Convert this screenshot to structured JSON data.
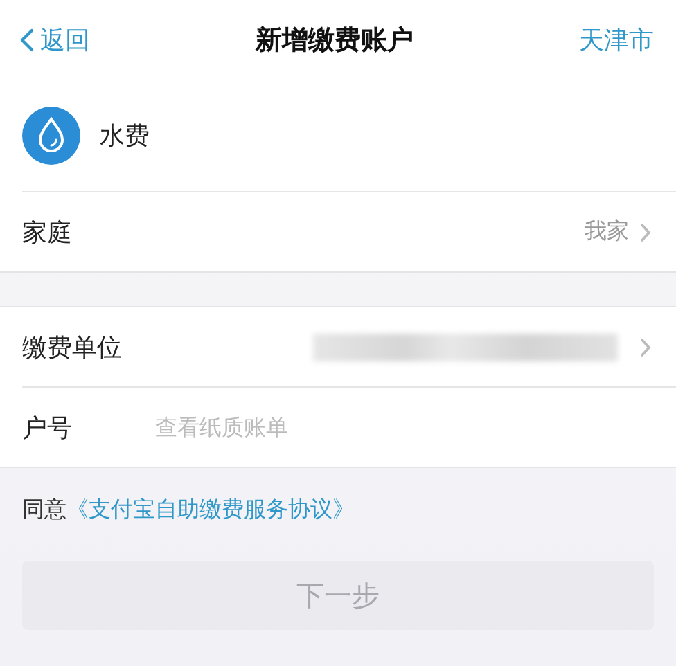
{
  "nav_bar": {
    "back": "返回",
    "title": "新增缴费账户",
    "city": "天津市"
  },
  "service": {
    "name": "水费"
  },
  "groups": [
    {
      "rows": [
        {
          "kind": "select",
          "label": "家庭",
          "value": "我家"
        }
      ]
    },
    {
      "rows": [
        {
          "kind": "select",
          "label": "缴费单位",
          "redacted": true
        },
        {
          "kind": "input",
          "label": "户号",
          "placeholder": "查看纸质账单"
        }
      ]
    }
  ],
  "agreement": {
    "prefix": "同意",
    "link": "《支付宝自助缴费服务协议》"
  },
  "next_button": {
    "label": "下一步",
    "disabled": true
  }
}
